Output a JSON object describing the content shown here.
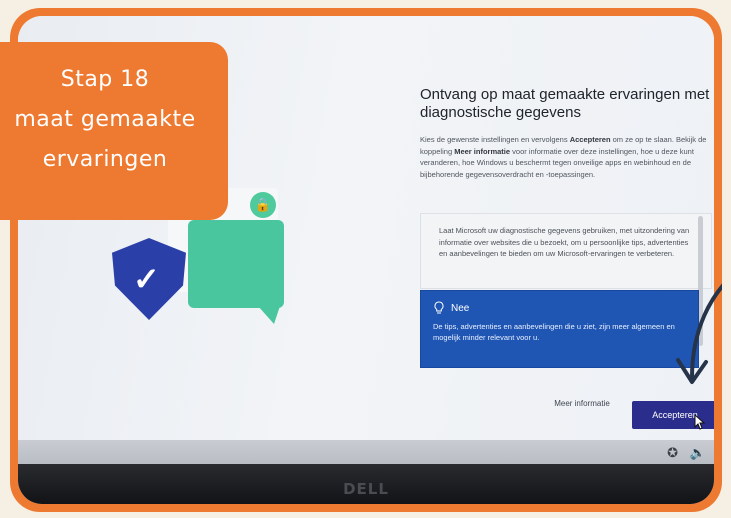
{
  "callout": {
    "lines": [
      "Stap 18",
      "maat gemaakte",
      "ervaringen"
    ]
  },
  "oobe": {
    "title": "Ontvang op maat gemaakte ervaringen met diagnostische gegevens",
    "description": {
      "part1": "Kies de gewenste instellingen en vervolgens ",
      "bold1": "Accepteren",
      "part2": " om ze op te slaan. Bekijk de koppeling ",
      "bold2": "Meer informatie",
      "part3": " voor informatie over deze instellingen, hoe u deze kunt veranderen, hoe Windows u beschermt tegen onveilige apps en webinhoud en de bijbehorende gegevensoverdracht en -toepassingen."
    },
    "option_yes_text": "Laat Microsoft uw diagnostische gegevens gebruiken, met uitzondering van informatie over websites die u bezoekt, om u persoonlijke tips, advertenties en aanbevelingen te bieden om uw Microsoft-ervaringen te verbeteren.",
    "option_no": {
      "label": "Nee",
      "text": "De tips, advertenties en aanbevelingen die u ziet, zijn meer algemeen en mogelijk minder relevant voor u."
    },
    "more_info_label": "Meer informatie",
    "accept_label": "Accepteren"
  },
  "hardware": {
    "brand": "DELL"
  },
  "icons": [
    "shield-check-icon",
    "lock-icon",
    "lightbulb-icon",
    "accessibility-icon",
    "volume-icon",
    "cursor-icon",
    "arrow-annotation-icon"
  ],
  "colors": {
    "accent": "#ee7a32",
    "selected": "#1f56b3",
    "button": "#2b2d8c",
    "shield": "#2b3fa8",
    "chat": "#49c69e"
  }
}
